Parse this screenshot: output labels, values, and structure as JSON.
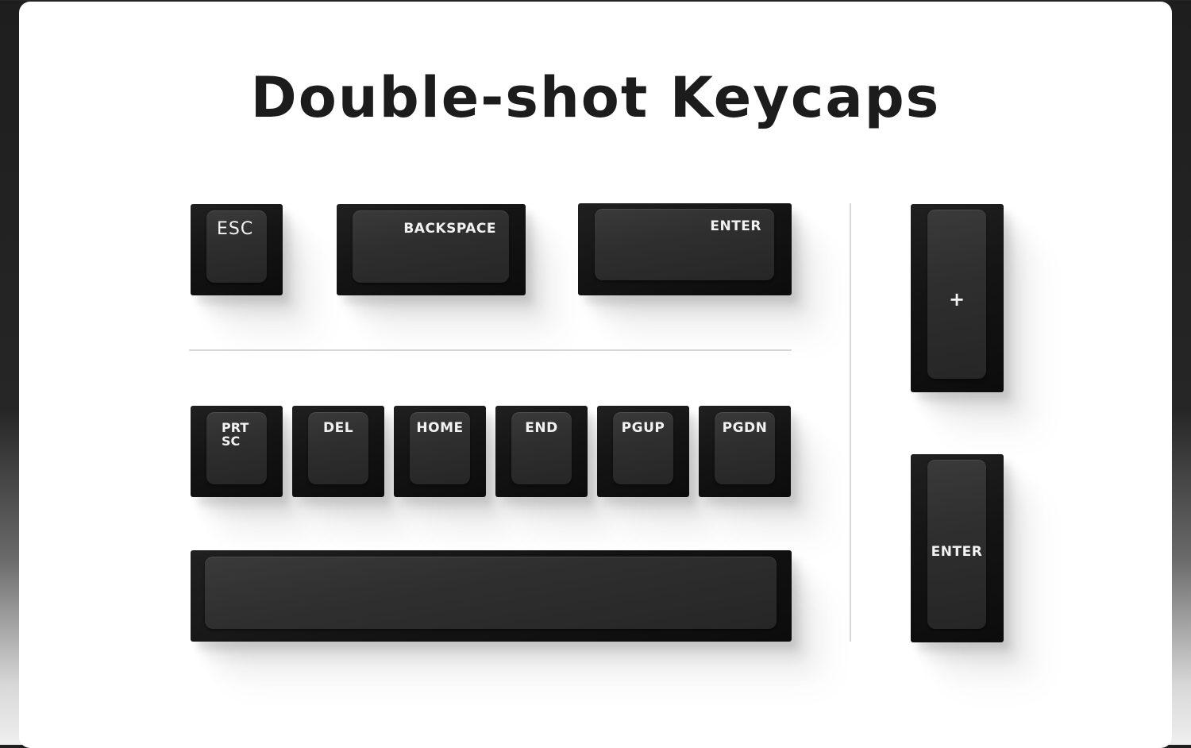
{
  "title": "Double-shot Keycaps",
  "colors": {
    "keycap": "#141414",
    "legend": "#f2f2f2",
    "background": "#ffffff"
  },
  "keys": {
    "esc": "ESC",
    "backspace": "BACKSPACE",
    "enter": "ENTER",
    "prtsc_line1": "PRT",
    "prtsc_line2": "SC",
    "del": "DEL",
    "home": "HOME",
    "end": "END",
    "pgup": "PGUP",
    "pgdn": "PGDN",
    "numpad_plus": "+",
    "numpad_enter": "ENTER",
    "spacebar": ""
  }
}
